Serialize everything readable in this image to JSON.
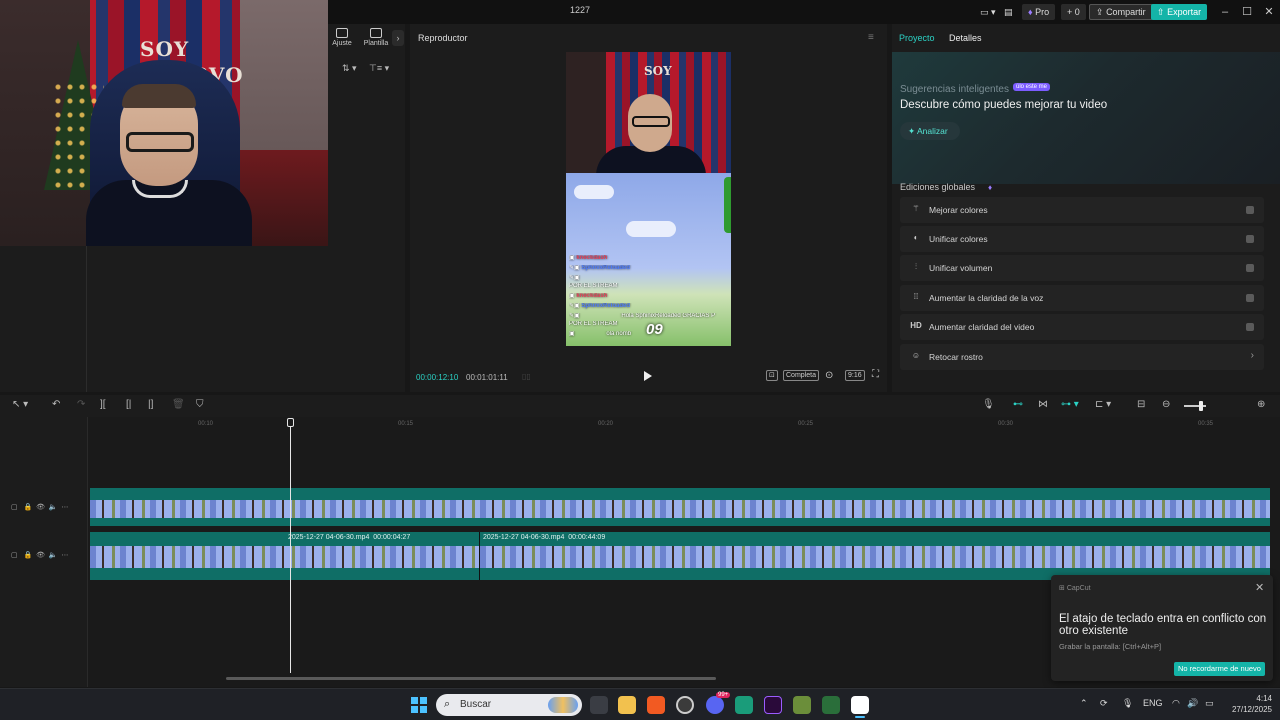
{
  "window": {
    "title": "1227"
  },
  "topbar": {
    "pro_label": "Pro",
    "credits": "0",
    "share_label": "Compartir",
    "export_label": "Exportar"
  },
  "webcam": {
    "wall_text_1": "SOY",
    "wall_text_2": "RVO"
  },
  "left_panel": {
    "tools": [
      {
        "label": "Ajuste"
      },
      {
        "label": "Plantilla"
      }
    ]
  },
  "player": {
    "title": "Reproductor",
    "preview_wall_text": "SOY",
    "current_time": "00:00:12:10",
    "total_time": "00:01:01:11",
    "quality_label": "Completa",
    "ratio_label": "9:16",
    "chat": [
      {
        "user": "kneckdash",
        "msg": ""
      },
      {
        "user": "SphinixReloaded",
        "msg": ""
      },
      {
        "user": "",
        "msg": "POR EL STREAM"
      },
      {
        "user": "kneckdash",
        "msg": ""
      },
      {
        "user": "SphinixReloaded",
        "msg": ""
      },
      {
        "user": "",
        "msg": "Hola SphinixReloaded GRACIAS P"
      },
      {
        "user": "",
        "msg": "POR EL STREAM"
      },
      {
        "user": "",
        "msg": "olá nomb"
      }
    ],
    "score": "09"
  },
  "right_panel": {
    "tabs": [
      {
        "label": "Proyecto",
        "active": true
      },
      {
        "label": "Detalles",
        "active": false
      }
    ],
    "suggestions_title": "Sugerencias inteligentes",
    "suggestions_badge": "úlo este me",
    "headline": "Descubre cómo puedes mejorar tu video",
    "analyze_label": "Analizar",
    "globals_title": "Ediciones globales",
    "options": [
      {
        "label": "Mejorar colores",
        "icon": "magic-wand-icon",
        "control": "toggle"
      },
      {
        "label": "Unificar colores",
        "icon": "palette-icon",
        "control": "toggle"
      },
      {
        "label": "Unificar volumen",
        "icon": "sliders-icon",
        "control": "toggle"
      },
      {
        "label": "Aumentar la claridad de la voz",
        "icon": "waveform-icon",
        "control": "toggle"
      },
      {
        "label": "Aumentar claridad del video",
        "icon": "hd-icon",
        "icon_text": "HD",
        "control": "toggle"
      },
      {
        "label": "Retocar rostro",
        "icon": "face-icon",
        "control": "chevron"
      }
    ]
  },
  "timeline": {
    "ruler": [
      "00:10",
      "00:15",
      "00:20",
      "00:25",
      "00:30",
      "00:35"
    ],
    "clips": [
      {
        "name": "2025-12-27 04-06-30.mp4",
        "duration": "00:00:04:27"
      },
      {
        "name": "2025-12-27 04-06-30.mp4",
        "duration": "00:00:44:09"
      }
    ]
  },
  "toast": {
    "app": "CapCut",
    "message": "El atajo de teclado entra en conflicto con otro existente",
    "detail": "Grabar la pantalla: [Ctrl+Alt+P]",
    "action_label": "No recordarme de nuevo"
  },
  "taskbar": {
    "search_placeholder": "Buscar",
    "language": "ENG",
    "time": "4:14",
    "date": "27/12/2025",
    "badge": "99+"
  },
  "colors": {
    "accent": "#2bd1c4",
    "export": "#14b4a8",
    "track": "#0f6e66",
    "pro": "#9a7cff"
  }
}
